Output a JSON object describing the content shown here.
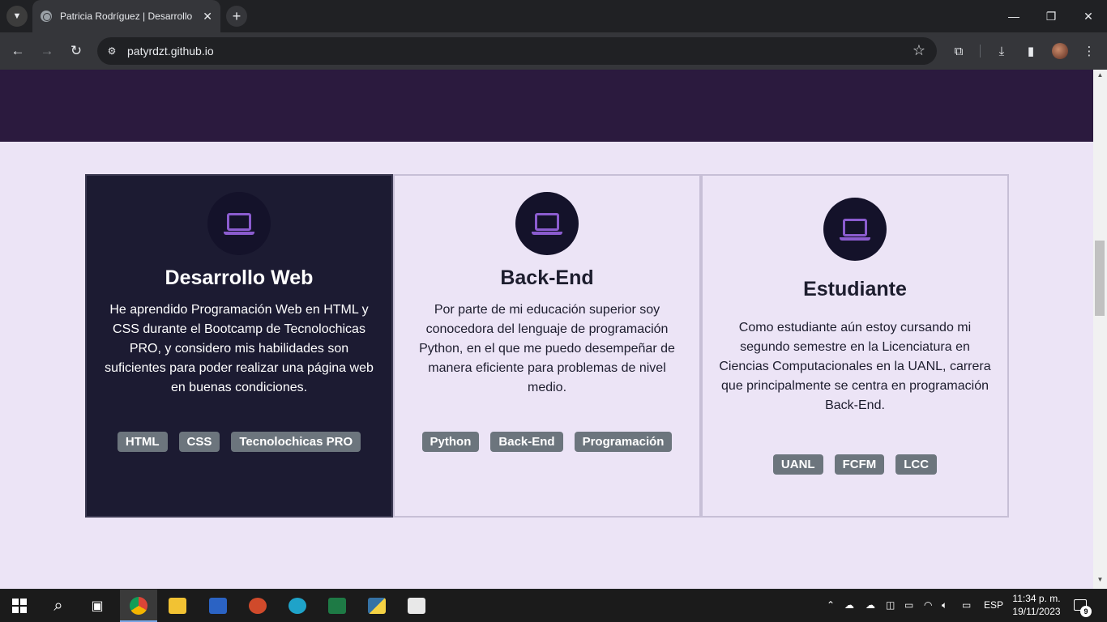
{
  "browser": {
    "tab_title": "Patricia Rodríguez | Desarrollo",
    "tab_close": "✕",
    "new_tab": "+",
    "url": "patyrdzt.github.io",
    "window_controls": {
      "minimize": "—",
      "maximize": "❐",
      "close": "✕"
    }
  },
  "cards": [
    {
      "title": "Desarrollo Web",
      "description": "He aprendido Programación Web en HTML y CSS durante el Bootcamp de Tecnolochicas PRO, y considero mis habilidades son suficientes para poder realizar una página web en buenas condiciones.",
      "tags": [
        "HTML",
        "CSS",
        "Tecnolochicas PRO"
      ],
      "icon": "laptop-icon"
    },
    {
      "title": "Back-End",
      "description": "Por parte de mi educación superior soy conocedora del lenguaje de programación Python, en el que me puedo desempeñar de manera eficiente para problemas de nivel medio.",
      "tags": [
        "Python",
        "Back-End",
        "Programación"
      ],
      "icon": "laptop-icon"
    },
    {
      "title": "Estudiante",
      "description": "Como estudiante aún estoy cursando mi segundo semestre en la Licenciatura en Ciencias Computacionales en la UANL, carrera que principalmente se centra en programación Back-End.",
      "tags": [
        "UANL",
        "FCFM",
        "LCC"
      ],
      "icon": "laptop-icon"
    }
  ],
  "colors": {
    "page_bg": "#ece4f6",
    "hero_band": "#2b1a3e",
    "dark_card": "#1c1b32",
    "icon_accent": "#8b5ccf",
    "tag_bg": "#6c757d"
  },
  "taskbar": {
    "language": "ESP",
    "time": "11:34 p. m.",
    "date": "19/11/2023",
    "notifications": "9"
  }
}
